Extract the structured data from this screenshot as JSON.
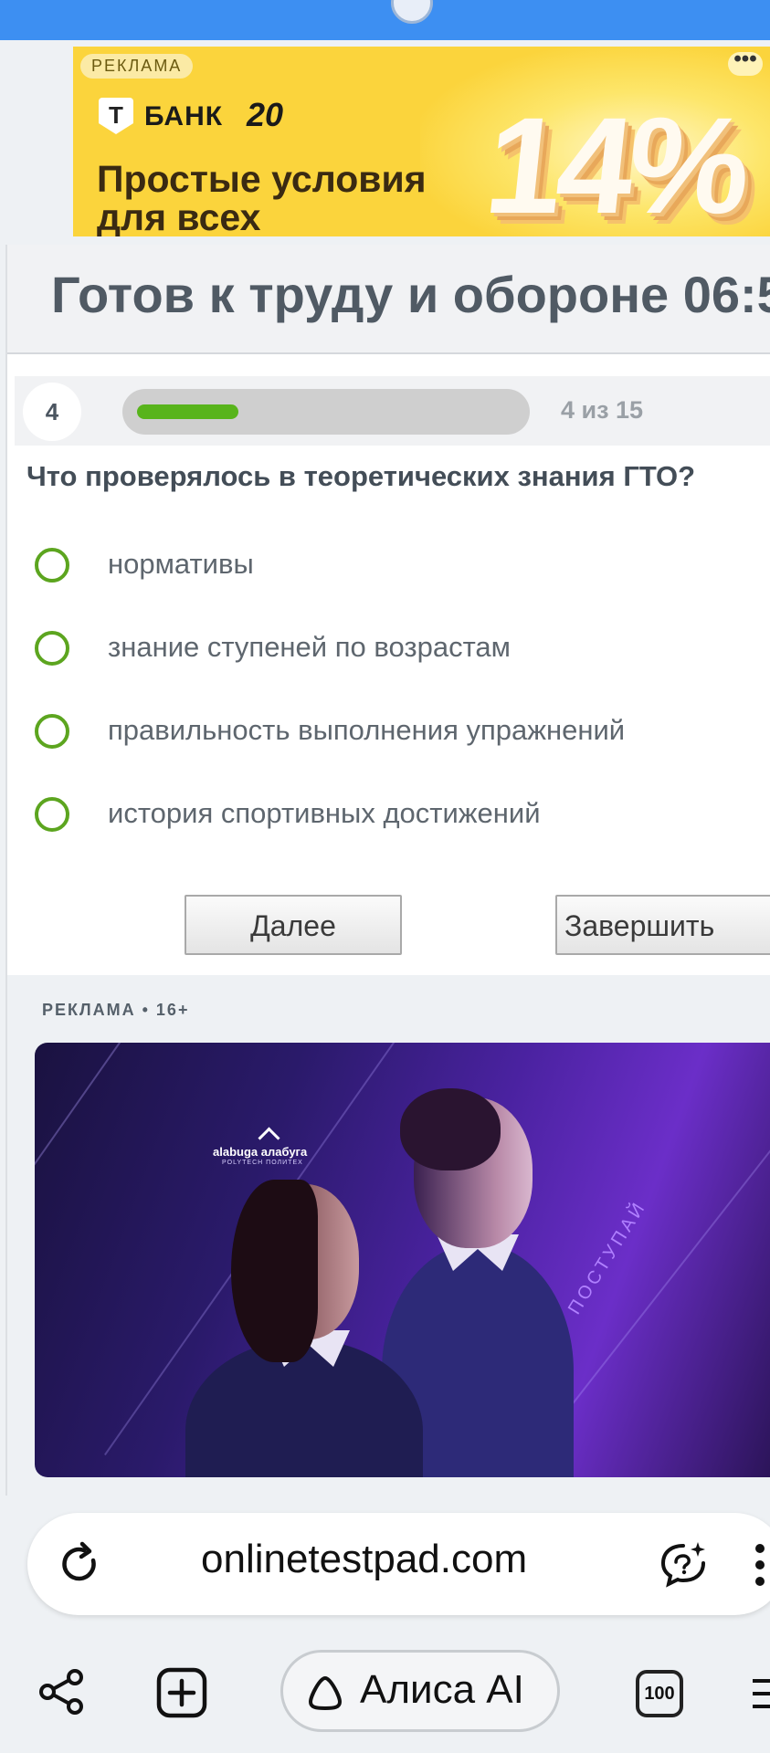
{
  "top_ad": {
    "badge": "РЕКЛАМА",
    "more": "•••",
    "brand_logo_letter": "Т",
    "brand_name": "БАНК",
    "brand_mark": "20",
    "headline_line1": "Простые условия",
    "headline_line2": "для всех",
    "big_number": "14%"
  },
  "test": {
    "title": "Готов к труду и обороне 06:5",
    "question_number": "4",
    "progress_text": "4 из 15",
    "progress_fraction": 0.267,
    "question": "Что проверялось в теоретических знания ГТО?",
    "answers": [
      "нормативы",
      "знание ступеней по возрастам",
      "правильность выполнения упражнений",
      "история спортивных достижений"
    ],
    "next_label": "Далее",
    "finish_label": "Завершить"
  },
  "bottom_ad": {
    "label": "РЕКЛАМА • 16+",
    "logo_text": "alabuga  алабуга",
    "logo_sub": "POLYTECH   ПОЛИТЕХ",
    "vertical_text": "ПОСТУПАЙ"
  },
  "browser": {
    "url": "onlinetestpad.com",
    "assistant_label": "Алиса AI",
    "tabs_count": "100"
  },
  "icons": {
    "reload": "reload-icon",
    "chat": "ai-chat-icon",
    "menu": "kebab-icon",
    "share": "share-icon",
    "new_tab": "new-tab-icon",
    "alice": "alice-icon",
    "tabs": "tabs-icon",
    "hamburger": "hamburger-icon"
  },
  "colors": {
    "status_bar": "#3d8ff2",
    "accent_green": "#58b41b",
    "ad_yellow": "#fbd43c"
  }
}
